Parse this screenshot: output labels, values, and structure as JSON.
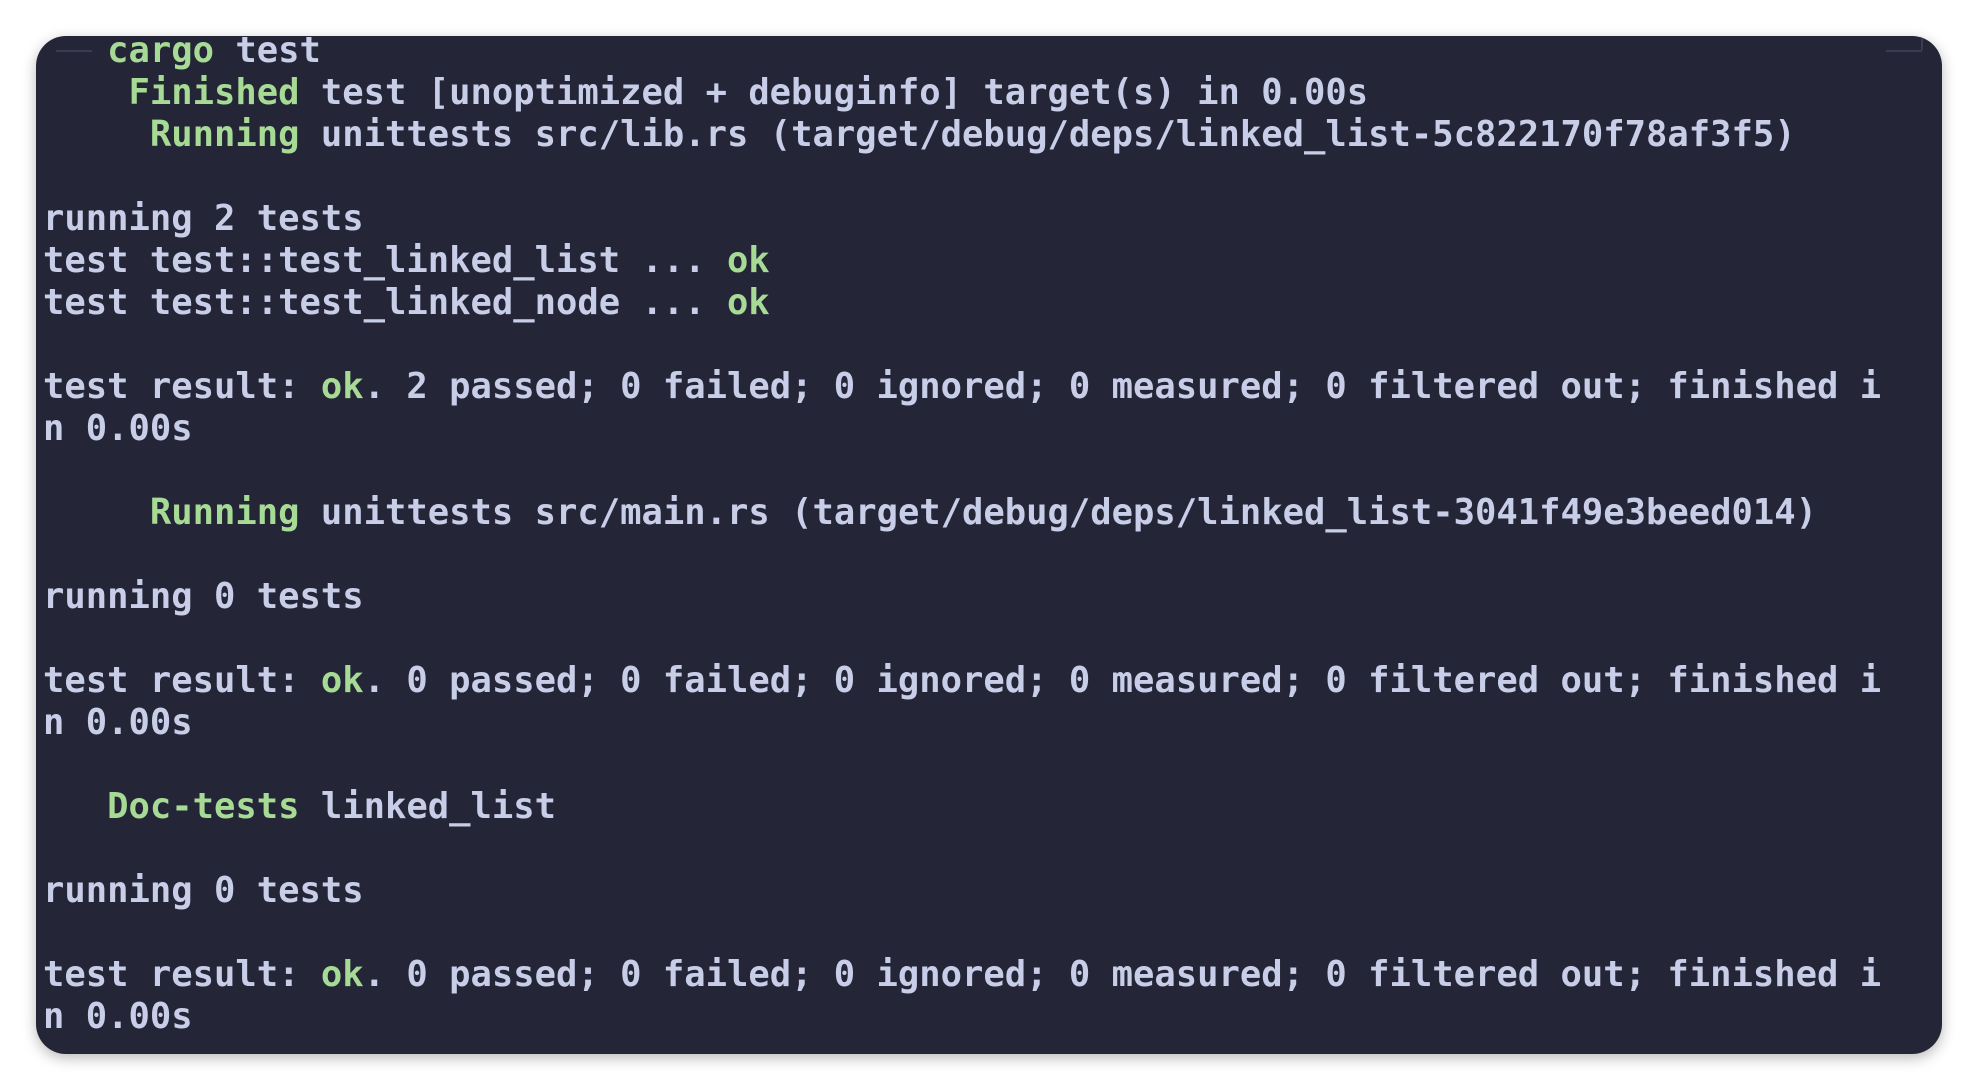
{
  "colors": {
    "background": "#242637",
    "text": "#c8cde8",
    "accent_green": "#a6da95"
  },
  "terminal": {
    "lines": [
      {
        "segments": [
          {
            "text": "   "
          },
          {
            "text": "cargo",
            "color": "green"
          },
          {
            "text": " test"
          }
        ]
      },
      {
        "segments": [
          {
            "text": "    "
          },
          {
            "text": "Finished",
            "color": "green"
          },
          {
            "text": " test [unoptimized + debuginfo] target(s) in 0.00s"
          }
        ]
      },
      {
        "segments": [
          {
            "text": "     "
          },
          {
            "text": "Running",
            "color": "green"
          },
          {
            "text": " unittests src/lib.rs (target/debug/deps/linked_list-5c822170f78af3f5)"
          }
        ]
      },
      {
        "segments": []
      },
      {
        "segments": [
          {
            "text": "running 2 tests"
          }
        ]
      },
      {
        "segments": [
          {
            "text": "test test::test_linked_list ... "
          },
          {
            "text": "ok",
            "color": "green"
          }
        ]
      },
      {
        "segments": [
          {
            "text": "test test::test_linked_node ... "
          },
          {
            "text": "ok",
            "color": "green"
          }
        ]
      },
      {
        "segments": []
      },
      {
        "segments": [
          {
            "text": "test result: "
          },
          {
            "text": "ok",
            "color": "green"
          },
          {
            "text": ". 2 passed; 0 failed; 0 ignored; 0 measured; 0 filtered out; finished i"
          }
        ]
      },
      {
        "segments": [
          {
            "text": "n 0.00s"
          }
        ]
      },
      {
        "segments": []
      },
      {
        "segments": [
          {
            "text": "     "
          },
          {
            "text": "Running",
            "color": "green"
          },
          {
            "text": " unittests src/main.rs (target/debug/deps/linked_list-3041f49e3beed014)"
          }
        ]
      },
      {
        "segments": []
      },
      {
        "segments": [
          {
            "text": "running 0 tests"
          }
        ]
      },
      {
        "segments": []
      },
      {
        "segments": [
          {
            "text": "test result: "
          },
          {
            "text": "ok",
            "color": "green"
          },
          {
            "text": ". 0 passed; 0 failed; 0 ignored; 0 measured; 0 filtered out; finished i"
          }
        ]
      },
      {
        "segments": [
          {
            "text": "n 0.00s"
          }
        ]
      },
      {
        "segments": []
      },
      {
        "segments": [
          {
            "text": "   "
          },
          {
            "text": "Doc-tests",
            "color": "green"
          },
          {
            "text": " linked_list"
          }
        ]
      },
      {
        "segments": []
      },
      {
        "segments": [
          {
            "text": "running 0 tests"
          }
        ]
      },
      {
        "segments": []
      },
      {
        "segments": [
          {
            "text": "test result: "
          },
          {
            "text": "ok",
            "color": "green"
          },
          {
            "text": ". 0 passed; 0 failed; 0 ignored; 0 measured; 0 filtered out; finished i"
          }
        ]
      },
      {
        "segments": [
          {
            "text": "n 0.00s"
          }
        ]
      }
    ]
  }
}
